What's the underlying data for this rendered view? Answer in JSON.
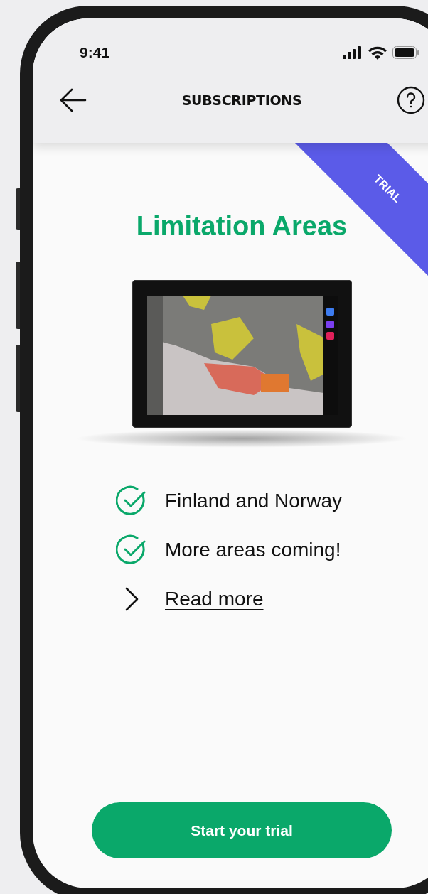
{
  "status_bar": {
    "time": "9:41"
  },
  "nav": {
    "title": "SUBSCRIPTIONS"
  },
  "ribbon": {
    "label": "TRIAL"
  },
  "title": "Limitation Areas",
  "features": [
    {
      "kind": "check",
      "text": "Finland and Norway"
    },
    {
      "kind": "check",
      "text": "More areas coming!"
    },
    {
      "kind": "link",
      "text": "Read more"
    }
  ],
  "button": {
    "label": "Start your trial"
  }
}
